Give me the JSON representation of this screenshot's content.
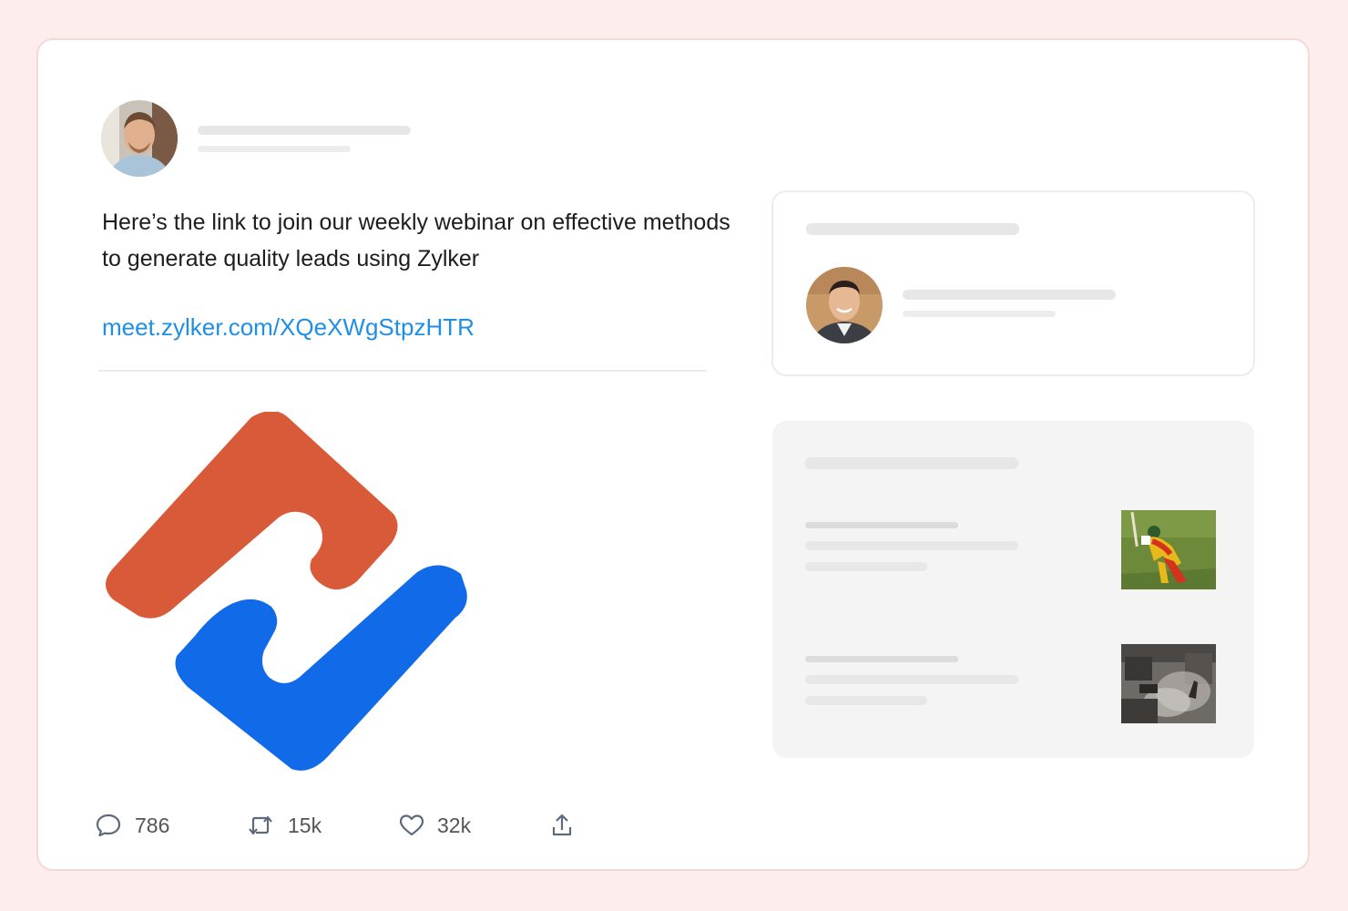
{
  "post": {
    "text": "Here’s the link to join our weekly webinar on effective methods to generate quality leads using Zylker",
    "link": "meet.zylker.com/XQeXWgStpzHTR",
    "author_avatar_icon": "person-avatar"
  },
  "stats": {
    "comments": "786",
    "reposts": "15k",
    "likes": "32k"
  },
  "icons": {
    "comment": "comment-bubble-icon",
    "repost": "repost-icon",
    "like": "heart-icon",
    "share": "share-upload-icon"
  },
  "colors": {
    "link": "#1f8fe6",
    "logo_orange": "#d85a38",
    "logo_blue": "#116ae8",
    "page_background": "#fdeeed"
  }
}
